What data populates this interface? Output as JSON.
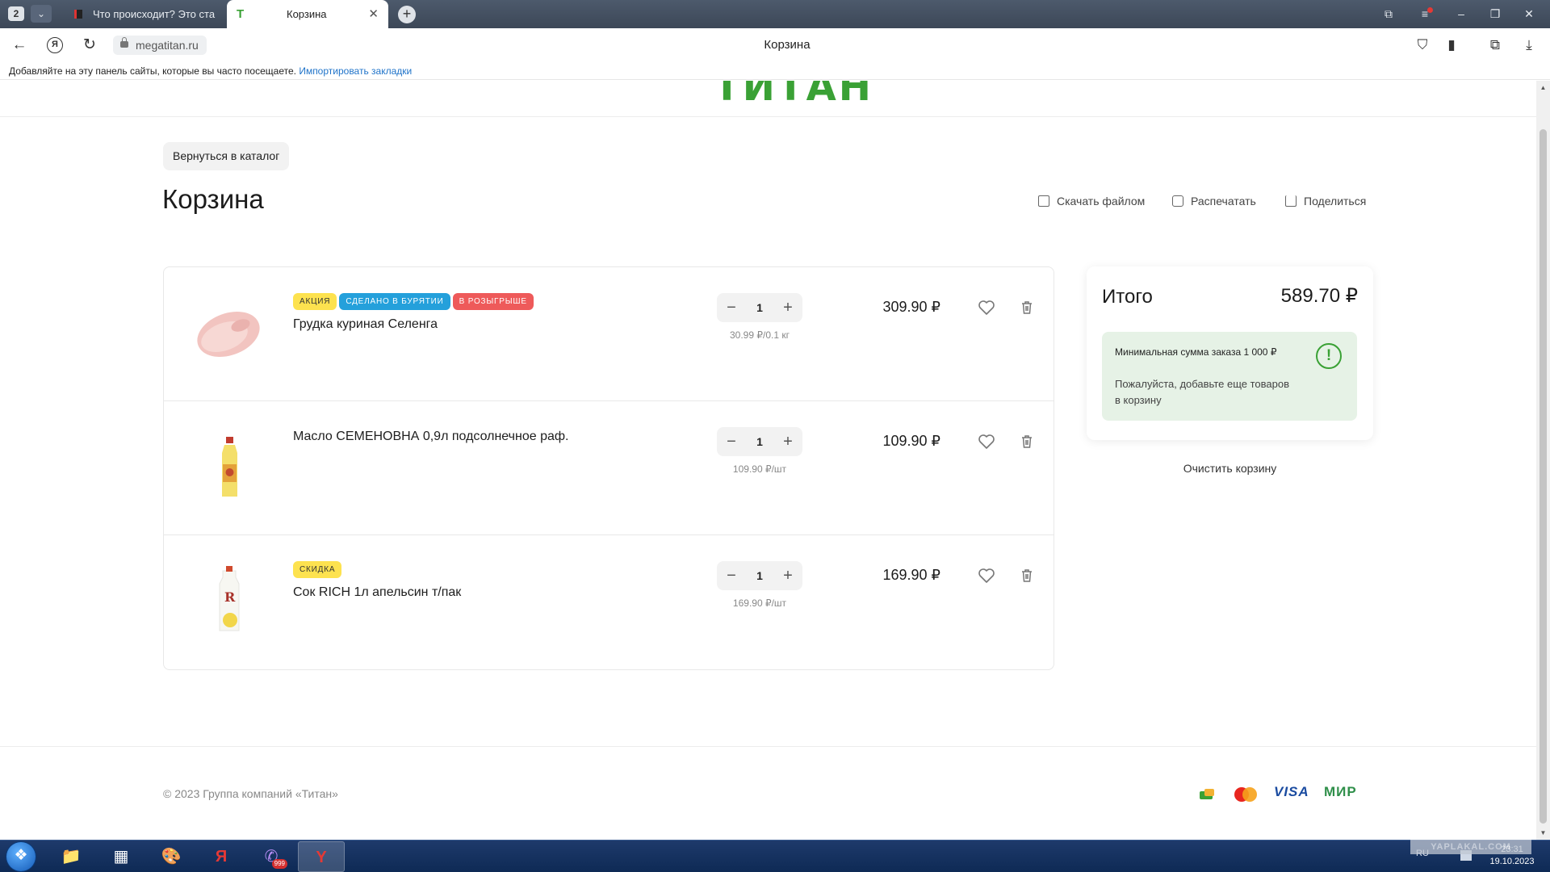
{
  "browser": {
    "tab_count": "2",
    "tabs": [
      {
        "title": "Что происходит? Это ста"
      },
      {
        "title": "Корзина"
      }
    ],
    "url": "megatitan.ru",
    "page_title": "Корзина",
    "bookmarks_hint": "Добавляйте на эту панель сайты, которые вы часто посещаете.",
    "import_bookmarks": "Импортировать закладки"
  },
  "header": {
    "logo_text": "ТИТАН"
  },
  "page": {
    "back_button": "Вернуться в каталог",
    "title": "Корзина",
    "actions": {
      "download": "Скачать файлом",
      "print": "Распечатать",
      "share": "Поделиться"
    }
  },
  "cart": {
    "items": [
      {
        "name": "Грудка куриная Селенга",
        "badges": [
          "АКЦИЯ",
          "СДЕЛАНО В БУРЯТИИ",
          "В РОЗЫГРЫШЕ"
        ],
        "quantity": "1",
        "unit_price": "30.99 ₽/0.1 кг",
        "price": "309.90 ₽"
      },
      {
        "name": "Масло СЕМЕНОВНА 0,9л подсолнечное раф.",
        "badges": [],
        "quantity": "1",
        "unit_price": "109.90 ₽/шт",
        "price": "109.90 ₽"
      },
      {
        "name": "Сок RICH 1л апельсин т/пак",
        "badges": [
          "СКИДКА"
        ],
        "quantity": "1",
        "unit_price": "169.90 ₽/шт",
        "price": "169.90 ₽"
      }
    ],
    "minus": "−",
    "plus": "+"
  },
  "summary": {
    "label": "Итого",
    "total": "589.70 ₽",
    "min_order": "Минимальная сумма заказа 1 000 ₽",
    "min_hint": "Пожалуйста, добавьте еще товаров в корзину",
    "clear_cart": "Очистить корзину"
  },
  "footer": {
    "copyright": "© 2023 Группа компаний «Титан»",
    "payments": [
      "VISA",
      "МИР"
    ]
  },
  "taskbar": {
    "lang": "RU",
    "time": "23:31",
    "date": "19.10.2023",
    "viber_badge": "999",
    "watermark": "YAPLAKAL.COM"
  },
  "colors": {
    "brand_green": "#3aa135",
    "badge_yellow": "#fde24f",
    "badge_blue": "#24a0db",
    "badge_red": "#ee5a5a"
  }
}
